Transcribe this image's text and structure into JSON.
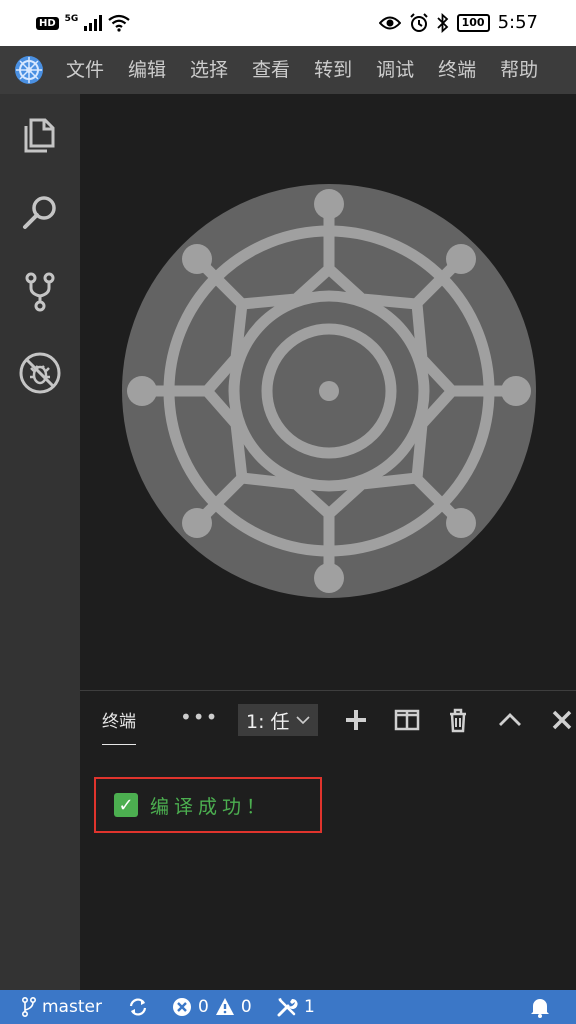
{
  "phone_status": {
    "hd": "HD",
    "network": "5G",
    "battery": "100",
    "time": "5:57"
  },
  "menu": {
    "items": [
      "文件",
      "编辑",
      "选择",
      "查看",
      "转到",
      "调试",
      "终端",
      "帮助"
    ]
  },
  "panel": {
    "tab_label": "终端",
    "more_label": "•••",
    "terminal_select": "1: 任"
  },
  "terminal": {
    "check_glyph": "✓",
    "output": "编译成功！"
  },
  "statusbar": {
    "branch": "master",
    "errors": "0",
    "warnings": "0",
    "tools_count": "1"
  },
  "colors": {
    "accent": "#3b77c7",
    "success": "#4caf50",
    "highlight_border": "#e0342d"
  }
}
